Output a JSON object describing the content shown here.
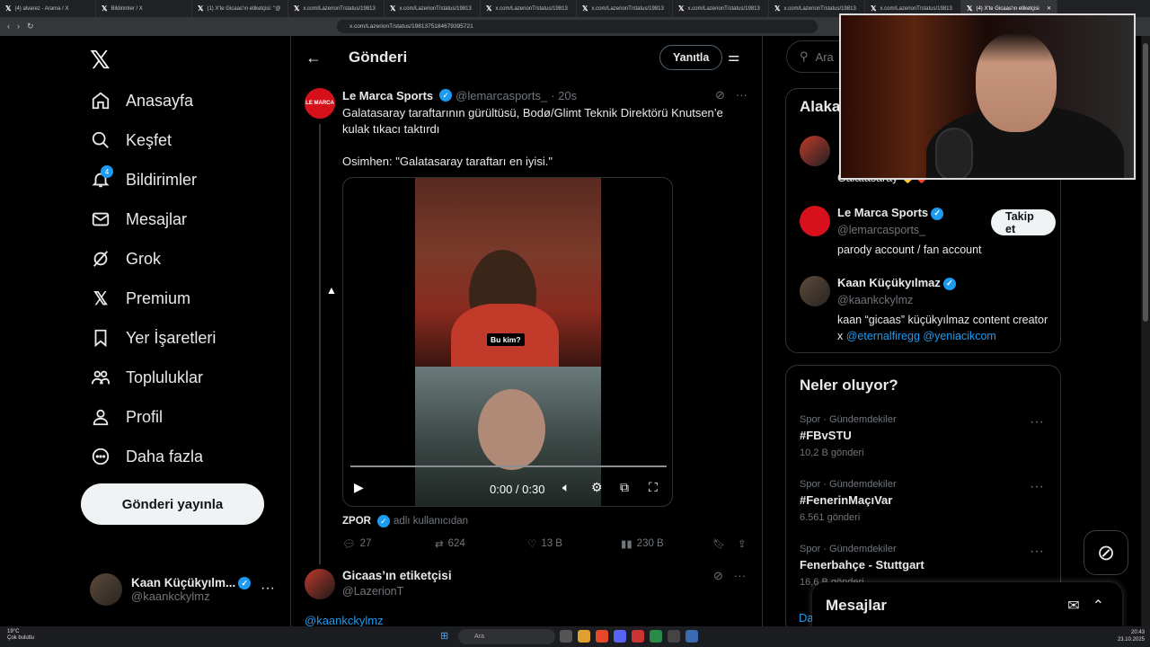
{
  "browser": {
    "tabs": [
      "(4) alvarez - Arama / X",
      "Bildirimler / X",
      "(1) X'te Gicaas'ın etiketçisi: \"@",
      "x.com/LazerionT/status/19813",
      "x.com/LazerionT/status/19813",
      "x.com/LazerionT/status/19813",
      "x.com/LazerionT/status/19813",
      "x.com/LazerionT/status/19813",
      "x.com/LazerionT/status/19813",
      "x.com/LazerionT/status/19813",
      "(4) X'te Gicaas'ın etiketçisi"
    ],
    "url": "x.com/LazerionT/status/1981375184679395721"
  },
  "sidebar": {
    "items": [
      {
        "label": "Anasayfa",
        "icon": "home-icon"
      },
      {
        "label": "Keşfet",
        "icon": "search-icon"
      },
      {
        "label": "Bildirimler",
        "icon": "bell-icon",
        "badge": "4"
      },
      {
        "label": "Mesajlar",
        "icon": "mail-icon"
      },
      {
        "label": "Grok",
        "icon": "grok-icon"
      },
      {
        "label": "Premium",
        "icon": "x-icon"
      },
      {
        "label": "Yer İşaretleri",
        "icon": "bookmark-icon"
      },
      {
        "label": "Topluluklar",
        "icon": "people-icon"
      },
      {
        "label": "Profil",
        "icon": "person-icon"
      },
      {
        "label": "Daha fazla",
        "icon": "more-icon"
      }
    ],
    "post_button": "Gönderi yayınla",
    "account": {
      "name": "Kaan Küçükyılm...",
      "handle": "@kaankckylmz"
    }
  },
  "header": {
    "title": "Gönderi",
    "reply_button": "Yanıtla"
  },
  "tweet": {
    "avatar_text": "LE MARCA",
    "name": "Le Marca Sports",
    "handle": "@lemarcasports_",
    "time": "· 20s",
    "text": "Galatasaray taraftarının gürültüsü, Bodø/Glimt Teknik Direktörü Knutsen’e kulak tıkacı taktırdı\n\nOsimhen: \"Galatasaray taraftarı en iyisi.\"",
    "video_caption": "Bu kim?",
    "video_time": "0:00 / 0:30",
    "video_progress": 0,
    "via_user": "ZPOR",
    "via_text": "adlı kullanıcıdan",
    "replies": "27",
    "reposts": "624",
    "likes": "13 B",
    "views": "230 B"
  },
  "reply": {
    "name": "Gicaas’ın etiketçisi",
    "handle": "@LazerionT",
    "mention": "@kaankckylmz"
  },
  "right": {
    "search_placeholder": "Ara",
    "related_title": "Alaka",
    "related_partial_text": "Galatasaray 💛❤️",
    "related": [
      {
        "name": "Le Marca Sports",
        "handle": "@lemarcasports_",
        "bio": "parody account / fan account",
        "follow": "Takip et"
      },
      {
        "name": "Kaan Küçükyılmaz",
        "handle": "@kaankckylmz",
        "bio": "kaan “gicaas” küçükyılmaz content creator x",
        "links": "@eternalfiregg @yeniacikcom"
      }
    ],
    "trends_title": "Neler oluyor?",
    "trends": [
      {
        "category": "Spor · Gündemdekiler",
        "title": "#FBvSTU",
        "count": "10,2 B gönderi"
      },
      {
        "category": "Spor · Gündemdekiler",
        "title": "#FenerinMaçıVar",
        "count": "6.561 gönderi"
      },
      {
        "category": "Spor · Gündemdekiler",
        "title": "Fenerbahçe - Stuttgart",
        "count": "16,6 B gönderi"
      }
    ],
    "messages_title": "Mesajlar",
    "partial_link": "Da"
  },
  "taskbar": {
    "weather_temp": "19°C",
    "weather_desc": "Çok bulutlu",
    "search": "Ara",
    "time": "20:43",
    "date": "23.10.2025"
  },
  "colors": {
    "accent": "#1d9bf0",
    "bg": "#000000",
    "border": "#2f3336",
    "muted": "#71767b"
  }
}
